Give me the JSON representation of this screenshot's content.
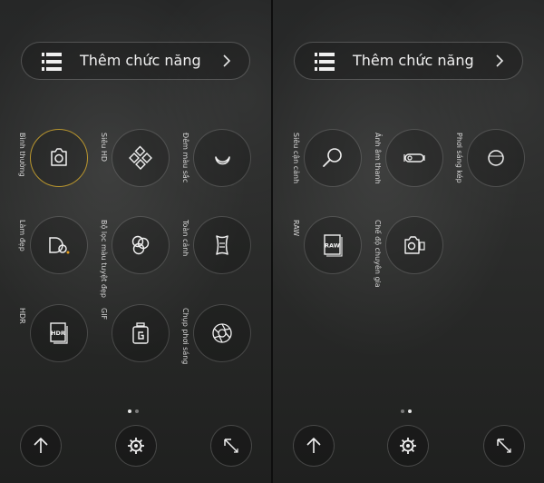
{
  "left_screen": {
    "add_feature_label": "Thêm chức năng",
    "modes": [
      {
        "id": "normal",
        "label": "Bình thường",
        "icon": "camera-icon",
        "selected": true
      },
      {
        "id": "super-hd",
        "label": "Siêu HD",
        "icon": "diamond-grid-icon"
      },
      {
        "id": "night",
        "label": "Đêm màu sắc",
        "icon": "crescent-moon-icon"
      },
      {
        "id": "beauty",
        "label": "Làm đẹp",
        "icon": "beauty-face-icon"
      },
      {
        "id": "filter",
        "label": "Bộ lọc màu tuyệt đẹp",
        "icon": "color-filter-icon"
      },
      {
        "id": "panorama",
        "label": "Toàn cảnh",
        "icon": "panorama-icon"
      },
      {
        "id": "hdr",
        "label": "HDR",
        "icon": "hdr-icon"
      },
      {
        "id": "gif",
        "label": "GIF",
        "icon": "gif-icon"
      },
      {
        "id": "exposure",
        "label": "Chụp phơi sáng",
        "icon": "aperture-icon"
      }
    ],
    "page_index": 0
  },
  "right_screen": {
    "add_feature_label": "Thêm chức năng",
    "modes": [
      {
        "id": "macro",
        "label": "Siêu cận cảnh",
        "icon": "magnifier-icon"
      },
      {
        "id": "sound-photo",
        "label": "Ảnh âm thanh",
        "icon": "sound-photo-icon"
      },
      {
        "id": "double-exposure",
        "label": "Phơi sáng kép",
        "icon": "double-exposure-icon"
      },
      {
        "id": "raw",
        "label": "RAW",
        "icon": "raw-icon"
      },
      {
        "id": "pro",
        "label": "Chế độ chuyên gia",
        "icon": "pro-camera-icon"
      }
    ],
    "page_index": 1
  },
  "bottom_bar": {
    "left_button": "arrow-up-icon",
    "center_button": "gear-icon",
    "right_button": "edit-pen-icon"
  },
  "colors": {
    "selected_ring": "#b8952e",
    "text": "#e8e8e8",
    "background": "#262727"
  }
}
